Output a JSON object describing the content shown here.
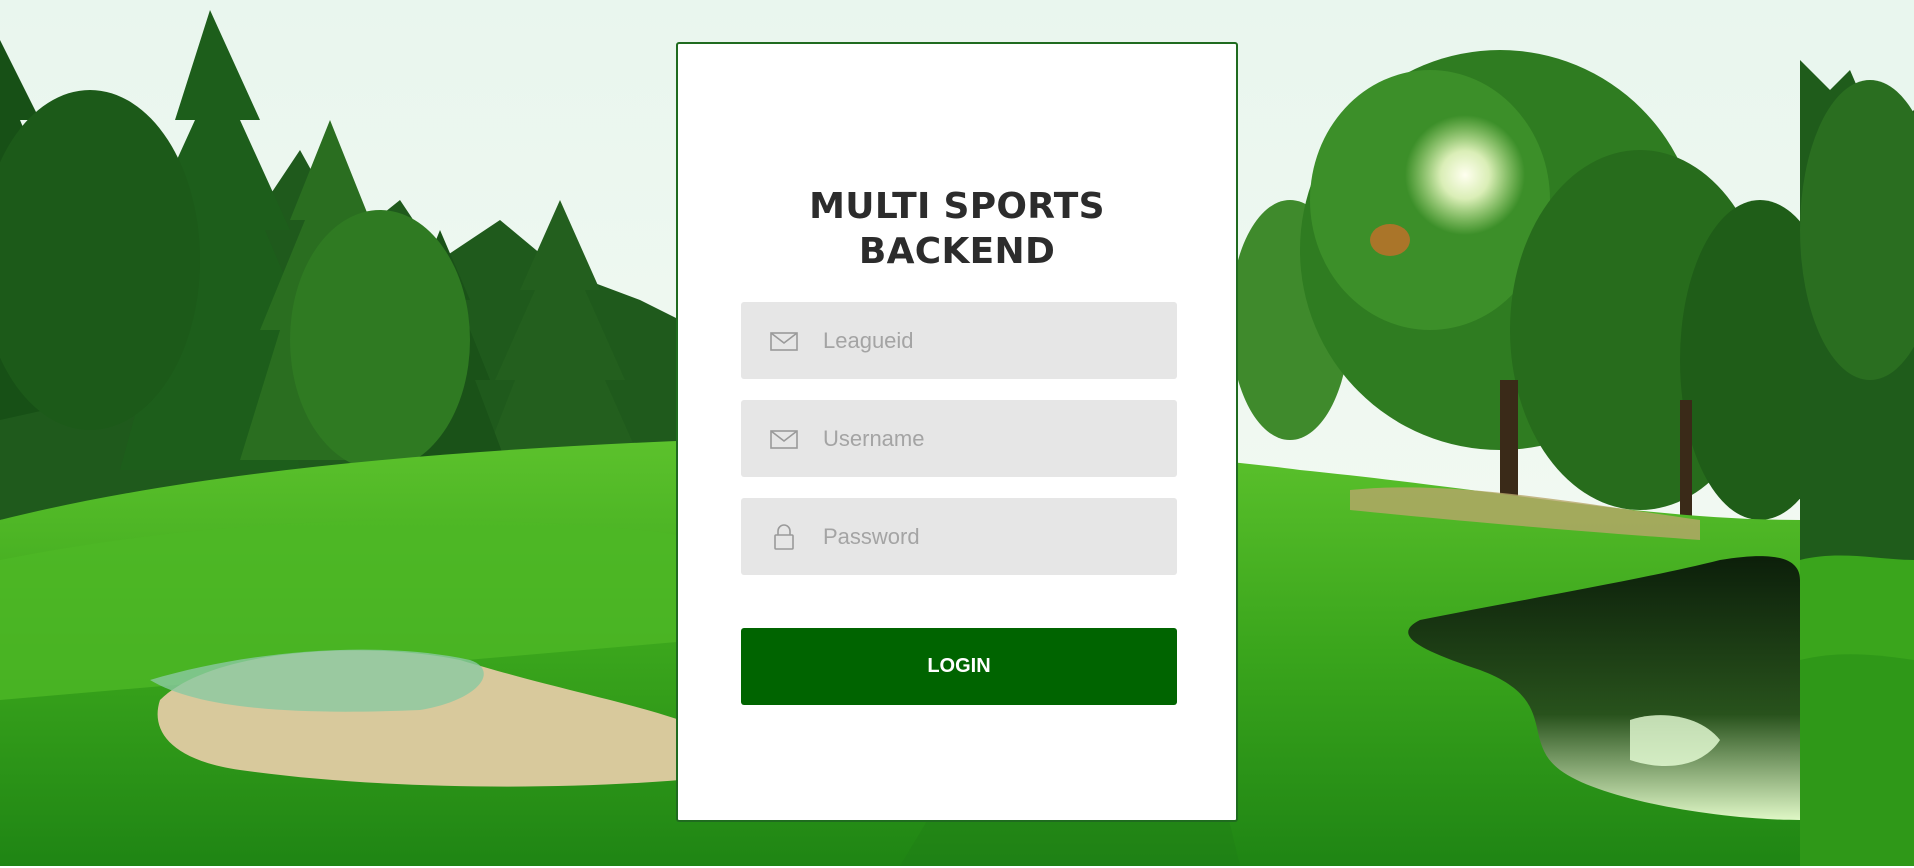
{
  "app": {
    "title": "MULTI SPORTS BACKEND",
    "title_lines": [
      "MULTI SPORTS",
      "BACKEND"
    ]
  },
  "form": {
    "fields": [
      {
        "id": "leagueid",
        "placeholder": "Leagueid",
        "value": "",
        "icon": "envelope-icon"
      },
      {
        "id": "username",
        "placeholder": "Username",
        "value": "",
        "icon": "envelope-icon"
      },
      {
        "id": "password",
        "placeholder": "Password",
        "value": "",
        "icon": "lock-icon"
      }
    ],
    "submit_label": "LOGIN"
  },
  "colors": {
    "accent": "#006400",
    "card_border": "#1f6b1f",
    "field_bg": "#e6e6e6",
    "title": "#2c2c2c",
    "placeholder": "#a4a4a4"
  },
  "background": {
    "scene": "golf-course-image"
  }
}
